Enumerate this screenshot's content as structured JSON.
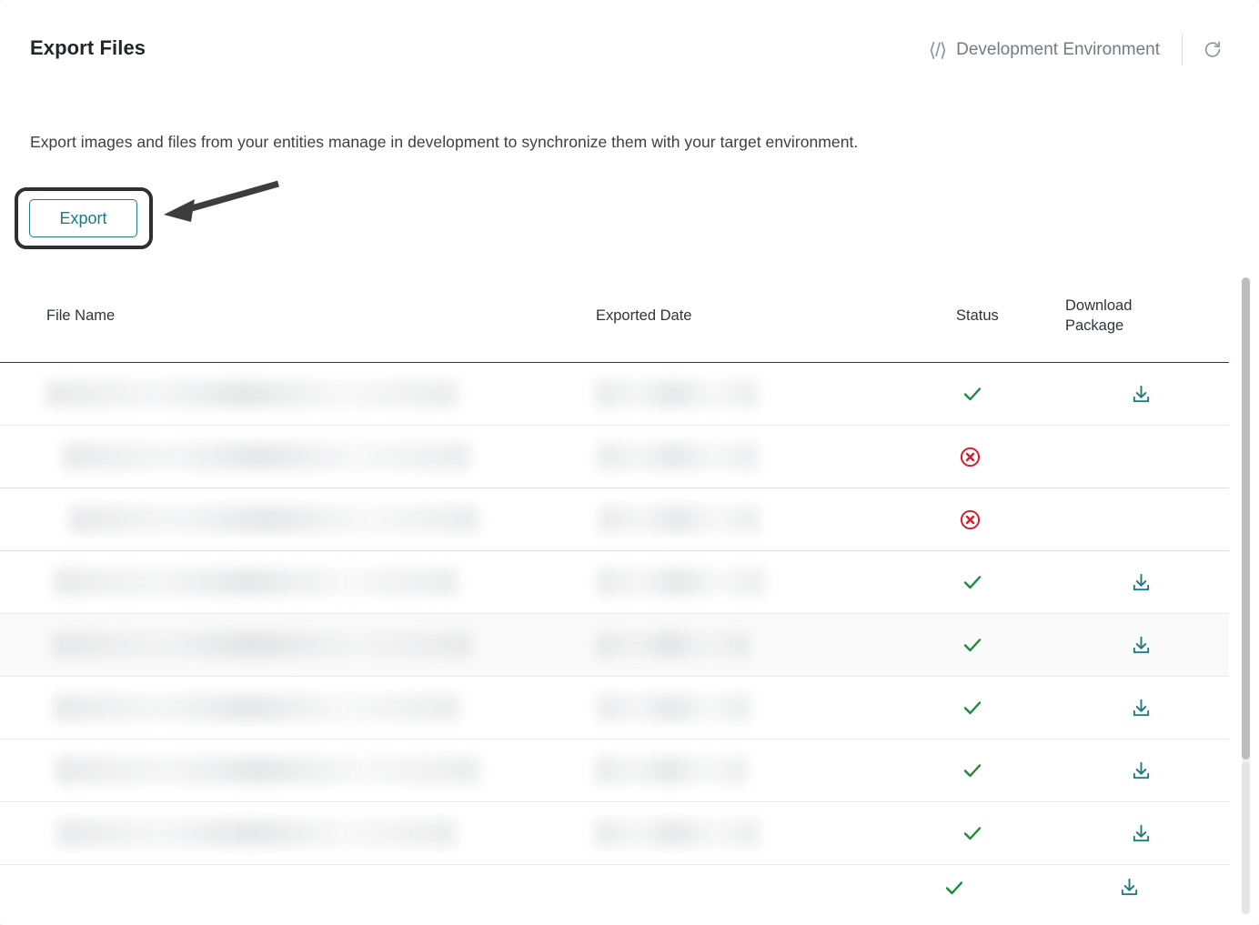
{
  "header": {
    "title": "Export Files",
    "environment_label": "Development Environment",
    "code_icon": "code-brackets-icon",
    "refresh_icon": "refresh-icon"
  },
  "description": "Export images and files from your entities manage in development to synchronize them with your target environment.",
  "actions": {
    "export_label": "Export",
    "annotation": "arrow-pointing-to-export-button"
  },
  "table": {
    "columns": [
      {
        "key": "file_name",
        "label": "File Name"
      },
      {
        "key": "exported_date",
        "label": "Exported Date"
      },
      {
        "key": "status",
        "label": "Status"
      },
      {
        "key": "download_package",
        "label_line1": "Download",
        "label_line2": "Package"
      }
    ],
    "rows": [
      {
        "file_name": "",
        "exported_date": "",
        "status": "success",
        "download": true,
        "highlight": false
      },
      {
        "file_name": "",
        "exported_date": "",
        "status": "error",
        "download": false,
        "highlight": false
      },
      {
        "file_name": "",
        "exported_date": "",
        "status": "error",
        "download": false,
        "highlight": false
      },
      {
        "file_name": "",
        "exported_date": "",
        "status": "success",
        "download": true,
        "highlight": false
      },
      {
        "file_name": "",
        "exported_date": "",
        "status": "success",
        "download": true,
        "highlight": true
      },
      {
        "file_name": "",
        "exported_date": "",
        "status": "success",
        "download": true,
        "highlight": false
      },
      {
        "file_name": "",
        "exported_date": "",
        "status": "success",
        "download": true,
        "highlight": false
      },
      {
        "file_name": "",
        "exported_date": "",
        "status": "success",
        "download": true,
        "highlight": false
      },
      {
        "file_name": "",
        "exported_date": "",
        "status": "success",
        "download": true,
        "highlight": false
      }
    ]
  },
  "colors": {
    "accent_teal": "#1d7a80",
    "status_success": "#1e8a3c",
    "status_error": "#d32030",
    "text_primary": "#22262b",
    "text_muted": "#737b82",
    "annotation": "#3d3d3d"
  },
  "scrollbar": {
    "orientation": "vertical",
    "thumb_position": "top"
  }
}
